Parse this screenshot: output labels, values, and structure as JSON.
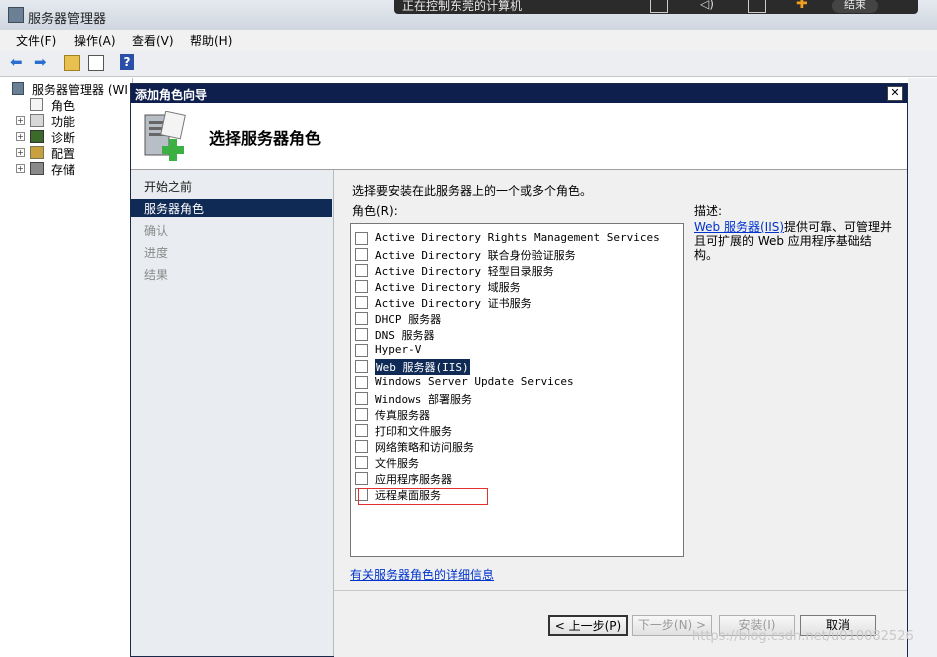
{
  "app": {
    "title": "服务器管理器"
  },
  "remote": {
    "text": "正在控制东莞的计算机",
    "end_label": "结束"
  },
  "menu": [
    "文件(F)",
    "操作(A)",
    "查看(V)",
    "帮助(H)"
  ],
  "tree": {
    "root": "服务器管理器 (WI",
    "items": [
      "角色",
      "功能",
      "诊断",
      "配置",
      "存储"
    ]
  },
  "wizard": {
    "title": "添加角色向导",
    "close": "✕",
    "header_title": "选择服务器角色",
    "nav": [
      "开始之前",
      "服务器角色",
      "确认",
      "进度",
      "结果"
    ],
    "instruction": "选择要安装在此服务器上的一个或多个角色。",
    "roles_label": "角色(R):",
    "roles": [
      "Active Directory Rights Management Services",
      "Active Directory 联合身份验证服务",
      "Active Directory 轻型目录服务",
      "Active Directory 域服务",
      "Active Directory 证书服务",
      "DHCP 服务器",
      "DNS 服务器",
      "Hyper-V",
      "Web 服务器(IIS)",
      "Windows Server Update Services",
      "Windows 部署服务",
      "传真服务器",
      "打印和文件服务",
      "网络策略和访问服务",
      "文件服务",
      "应用程序服务器",
      "远程桌面服务"
    ],
    "selected_role_index": 8,
    "description_label": "描述:",
    "description_link": "Web 服务器(IIS)",
    "description_text": "提供可靠、可管理并且可扩展的 Web 应用程序基础结构。",
    "more_info_link": "有关服务器角色的详细信息",
    "buttons": {
      "prev": "< 上一步(P)",
      "next": "下一步(N) >",
      "install": "安装(I)",
      "cancel": "取消"
    }
  },
  "watermark": "https://blog.csdn.net/u010082526"
}
